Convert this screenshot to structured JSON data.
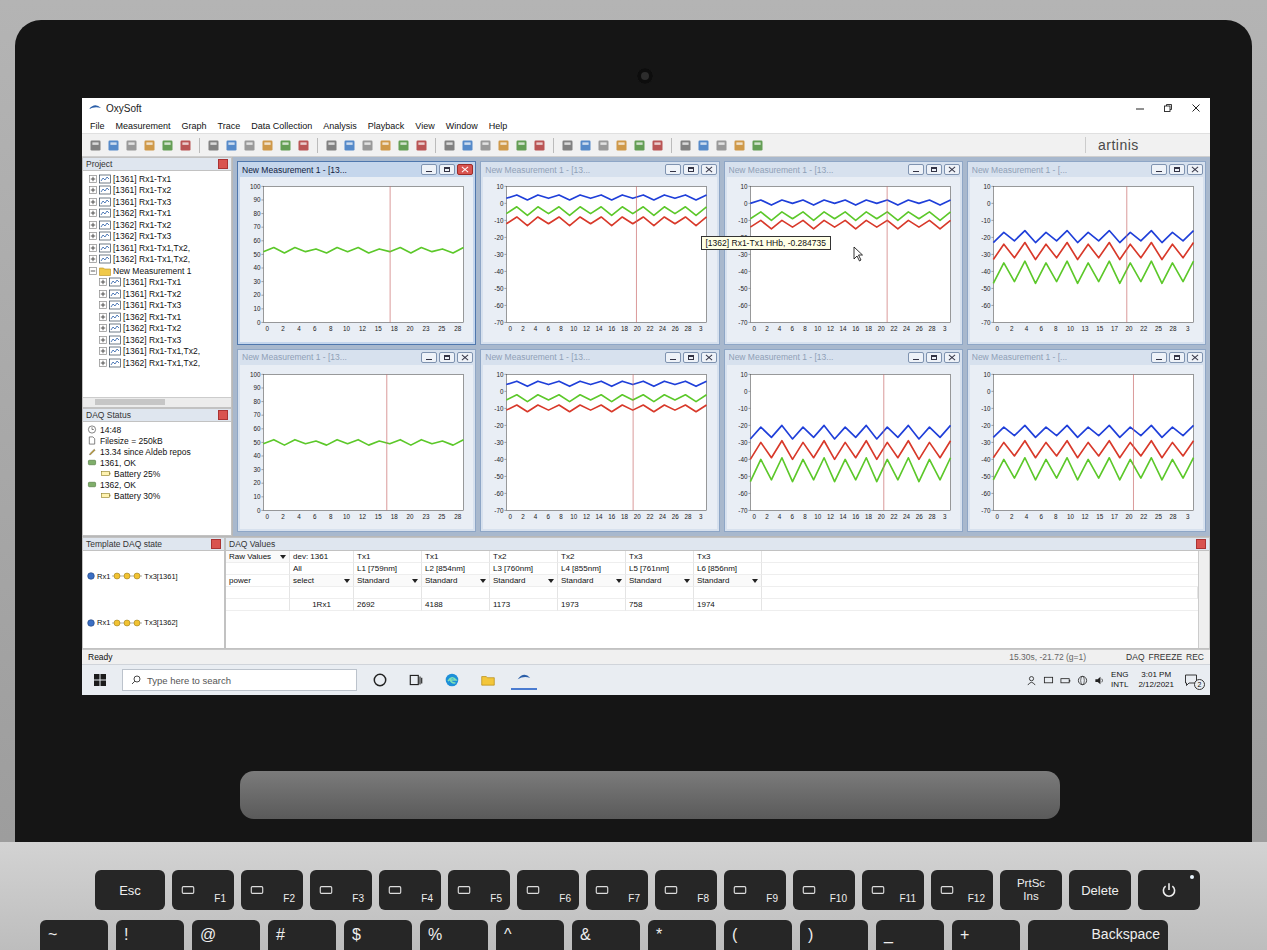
{
  "window": {
    "title": "OxySoft"
  },
  "menu": [
    "File",
    "Measurement",
    "Graph",
    "Trace",
    "Data Collection",
    "Analysis",
    "Playback",
    "View",
    "Window",
    "Help"
  ],
  "toolbar": {
    "logo": "artinis"
  },
  "project": {
    "title": "Project",
    "items": [
      {
        "label": "[1361] Rx1-Tx1",
        "kind": "channel",
        "expanded": false
      },
      {
        "label": "[1361] Rx1-Tx2",
        "kind": "channel",
        "expanded": false
      },
      {
        "label": "[1361] Rx1-Tx3",
        "kind": "channel",
        "expanded": false
      },
      {
        "label": "[1362] Rx1-Tx1",
        "kind": "channel",
        "expanded": false
      },
      {
        "label": "[1362] Rx1-Tx2",
        "kind": "channel",
        "expanded": false
      },
      {
        "label": "[1362] Rx1-Tx3",
        "kind": "channel",
        "expanded": false
      },
      {
        "label": "[1361] Rx1-Tx1,Tx2,",
        "kind": "channel",
        "expanded": false
      },
      {
        "label": "[1362] Rx1-Tx1,Tx2,",
        "kind": "channel",
        "expanded": false
      },
      {
        "label": "New Measurement 1",
        "kind": "folder",
        "expanded": true
      },
      {
        "label": "[1361] Rx1-Tx1",
        "kind": "channel",
        "expanded": false
      },
      {
        "label": "[1361] Rx1-Tx2",
        "kind": "channel",
        "expanded": false
      },
      {
        "label": "[1361] Rx1-Tx3",
        "kind": "channel",
        "expanded": false
      },
      {
        "label": "[1362] Rx1-Tx1",
        "kind": "channel",
        "expanded": false
      },
      {
        "label": "[1362] Rx1-Tx2",
        "kind": "channel",
        "expanded": false
      },
      {
        "label": "[1362] Rx1-Tx3",
        "kind": "channel",
        "expanded": false
      },
      {
        "label": "[1361] Rx1-Tx1,Tx2,",
        "kind": "channel",
        "expanded": false
      },
      {
        "label": "[1362] Rx1-Tx1,Tx2,",
        "kind": "channel",
        "expanded": false
      }
    ]
  },
  "daq_status": {
    "title": "DAQ Status",
    "items": [
      {
        "text": "14:48",
        "kind": "clock"
      },
      {
        "text": "Filesize = 250kB",
        "kind": "file"
      },
      {
        "text": "13.34 since Aldeb repos",
        "kind": "info"
      },
      {
        "text": "1361, OK",
        "kind": "device"
      },
      {
        "text": "Battery 25%",
        "kind": "battery"
      },
      {
        "text": "1362, OK",
        "kind": "device"
      },
      {
        "text": "Battery 30%",
        "kind": "battery"
      }
    ]
  },
  "charts": [
    {
      "title": "New Measurement 1 - [13...",
      "active": true,
      "y_max": 100,
      "y_min": 0,
      "y_ticks": [
        "100",
        "90",
        "80",
        "70",
        "60",
        "50",
        "40",
        "30",
        "20",
        "10",
        "0"
      ],
      "x_ticks": [
        "0",
        "2",
        "4",
        "6",
        "8",
        "10",
        "12",
        "15",
        "18",
        "20",
        "23",
        "25",
        "28"
      ],
      "x_max": 30,
      "cursor": 19,
      "series": [
        {
          "color": "#5cc82a",
          "values": [
            52,
            55,
            51,
            55,
            52,
            54,
            51,
            55,
            52,
            55,
            51,
            54,
            52,
            55,
            51,
            55,
            52,
            54,
            51,
            55
          ]
        }
      ]
    },
    {
      "title": "New Measurement 1 - [13...",
      "active": false,
      "y_max": 10,
      "y_min": -70,
      "y_ticks": [
        "10",
        "0",
        "-10",
        "-20",
        "-30",
        "-40",
        "-50",
        "-60",
        "-70"
      ],
      "x_ticks": [
        "0",
        "2",
        "4",
        "6",
        "8",
        "10",
        "12",
        "14",
        "16",
        "18",
        "20",
        "22",
        "24",
        "26",
        "28",
        "3"
      ],
      "x_max": 30,
      "cursor": 19.5,
      "series": [
        {
          "color": "#1f3fd9",
          "values": [
            3,
            5,
            2,
            5,
            3,
            5,
            2,
            5,
            3,
            5,
            2,
            5,
            3,
            5,
            2,
            5,
            3,
            5,
            2,
            5
          ]
        },
        {
          "color": "#5cc82a",
          "values": [
            -6,
            -2,
            -7,
            -2,
            -6,
            -2,
            -7,
            -2,
            -6,
            -2,
            -7,
            -2,
            -6,
            -2,
            -7,
            -2,
            -6,
            -2,
            -7,
            -2
          ]
        },
        {
          "color": "#d8392a",
          "values": [
            -12,
            -8,
            -13,
            -8,
            -12,
            -8,
            -13,
            -8,
            -12,
            -8,
            -13,
            -8,
            -12,
            -8,
            -13,
            -8,
            -12,
            -8,
            -13,
            -8
          ]
        }
      ]
    },
    {
      "title": "New Measurement 1 - [13...",
      "active": false,
      "y_max": 10,
      "y_min": -70,
      "y_ticks": [
        "10",
        "0",
        "-10",
        "-20",
        "-30",
        "-40",
        "-50",
        "-60",
        "-70"
      ],
      "x_ticks": [
        "0",
        "2",
        "4",
        "6",
        "8",
        "10",
        "12",
        "14",
        "16",
        "18",
        "20",
        "22",
        "24",
        "26",
        "28",
        "3"
      ],
      "x_max": 30,
      "cursor": 20.5,
      "tooltip": "[1362] Rx1-Tx1 HHb, -0.284735",
      "series": [
        {
          "color": "#1f3fd9",
          "values": [
            0,
            2,
            -1,
            2,
            0,
            2,
            -1,
            2,
            0,
            2,
            -1,
            2,
            0,
            2,
            -1,
            2,
            0,
            2,
            -1,
            2
          ]
        },
        {
          "color": "#5cc82a",
          "values": [
            -9,
            -5,
            -10,
            -5,
            -9,
            -5,
            -10,
            -5,
            -9,
            -5,
            -10,
            -5,
            -9,
            -5,
            -10,
            -5,
            -9,
            -5,
            -10,
            -5
          ]
        },
        {
          "color": "#d8392a",
          "values": [
            -14,
            -10,
            -15,
            -10,
            -14,
            -10,
            -15,
            -10,
            -14,
            -10,
            -15,
            -10,
            -14,
            -10,
            -15,
            -10,
            -14,
            -10,
            -15,
            -10
          ]
        }
      ]
    },
    {
      "title": "New Measurement 1 - [...",
      "active": false,
      "y_max": 10,
      "y_min": -70,
      "y_ticks": [
        "10",
        "0",
        "-10",
        "-20",
        "-30",
        "-40",
        "-50",
        "-60",
        "-70"
      ],
      "x_ticks": [
        "0",
        "2",
        "4",
        "6",
        "8",
        "10",
        "13",
        "15",
        "17",
        "20",
        "22",
        "25",
        "28",
        "3"
      ],
      "x_max": 30,
      "cursor": 20,
      "series": [
        {
          "color": "#1f3fd9",
          "values": [
            -23,
            -17,
            -22,
            -16,
            -23,
            -17,
            -22,
            -16,
            -23,
            -17,
            -22,
            -16,
            -23,
            -17,
            -22,
            -16,
            -23,
            -17,
            -22,
            -16
          ]
        },
        {
          "color": "#d8392a",
          "values": [
            -33,
            -24,
            -32,
            -23,
            -33,
            -24,
            -32,
            -23,
            -33,
            -24,
            -32,
            -23,
            -33,
            -24,
            -32,
            -23,
            -33,
            -24,
            -32,
            -23
          ]
        },
        {
          "color": "#5cc82a",
          "values": [
            -47,
            -35,
            -46,
            -34,
            -47,
            -35,
            -46,
            -34,
            -47,
            -35,
            -46,
            -34,
            -47,
            -35,
            -46,
            -34,
            -47,
            -35,
            -46,
            -34
          ]
        }
      ]
    },
    {
      "title": "New Measurement 1 - [13...",
      "active": false,
      "y_max": 100,
      "y_min": 0,
      "y_ticks": [
        "100",
        "90",
        "80",
        "70",
        "60",
        "50",
        "40",
        "30",
        "20",
        "10",
        "0"
      ],
      "x_ticks": [
        "0",
        "2",
        "4",
        "6",
        "8",
        "10",
        "12",
        "15",
        "18",
        "20",
        "23",
        "25",
        "28"
      ],
      "x_max": 30,
      "cursor": 18.5,
      "series": [
        {
          "color": "#5cc82a",
          "values": [
            49,
            52,
            48,
            52,
            49,
            51,
            48,
            52,
            49,
            52,
            48,
            51,
            49,
            52,
            48,
            52,
            49,
            51,
            48,
            52
          ]
        }
      ]
    },
    {
      "title": "New Measurement 1 - [13...",
      "active": false,
      "y_max": 10,
      "y_min": -70,
      "y_ticks": [
        "10",
        "0",
        "-10",
        "-20",
        "-30",
        "-40",
        "-50",
        "-60",
        "-70"
      ],
      "x_ticks": [
        "0",
        "2",
        "4",
        "6",
        "8",
        "10",
        "12",
        "14",
        "16",
        "18",
        "20",
        "22",
        "24",
        "26",
        "28",
        "3"
      ],
      "x_max": 30,
      "cursor": 19,
      "series": [
        {
          "color": "#1f3fd9",
          "values": [
            4,
            6,
            3,
            6,
            4,
            6,
            3,
            6,
            4,
            6,
            3,
            6,
            4,
            6,
            3,
            6,
            4,
            6,
            3,
            6
          ]
        },
        {
          "color": "#5cc82a",
          "values": [
            -5,
            -2,
            -6,
            -2,
            -5,
            -2,
            -6,
            -2,
            -5,
            -2,
            -6,
            -2,
            -5,
            -2,
            -6,
            -2,
            -5,
            -2,
            -6,
            -2
          ]
        },
        {
          "color": "#d8392a",
          "values": [
            -11,
            -8,
            -12,
            -8,
            -11,
            -8,
            -12,
            -8,
            -11,
            -8,
            -12,
            -8,
            -11,
            -8,
            -12,
            -8,
            -11,
            -8,
            -12,
            -8
          ]
        }
      ]
    },
    {
      "title": "New Measurement 1 - [13...",
      "active": false,
      "y_max": 10,
      "y_min": -70,
      "y_ticks": [
        "10",
        "0",
        "-10",
        "-20",
        "-30",
        "-40",
        "-50",
        "-60",
        "-70"
      ],
      "x_ticks": [
        "0",
        "2",
        "4",
        "6",
        "8",
        "10",
        "12",
        "14",
        "16",
        "18",
        "20",
        "22",
        "24",
        "26",
        "28",
        "3"
      ],
      "x_max": 30,
      "cursor": 20,
      "series": [
        {
          "color": "#1f3fd9",
          "values": [
            -28,
            -21,
            -27,
            -20,
            -28,
            -21,
            -27,
            -20,
            -28,
            -21,
            -27,
            -20,
            -28,
            -21,
            -27,
            -20,
            -28,
            -21,
            -27,
            -20
          ]
        },
        {
          "color": "#d8392a",
          "values": [
            -40,
            -30,
            -39,
            -29,
            -40,
            -30,
            -39,
            -29,
            -40,
            -30,
            -39,
            -29,
            -40,
            -30,
            -39,
            -29,
            -40,
            -30,
            -39,
            -29
          ]
        },
        {
          "color": "#5cc82a",
          "values": [
            -53,
            -40,
            -52,
            -39,
            -53,
            -40,
            -52,
            -39,
            -53,
            -40,
            -52,
            -39,
            -53,
            -40,
            -52,
            -39,
            -53,
            -40,
            -52,
            -39
          ]
        }
      ]
    },
    {
      "title": "New Measurement 1 - [...",
      "active": false,
      "y_max": 10,
      "y_min": -70,
      "y_ticks": [
        "10",
        "0",
        "-10",
        "-20",
        "-30",
        "-40",
        "-50",
        "-60",
        "-70"
      ],
      "x_ticks": [
        "0",
        "2",
        "4",
        "6",
        "8",
        "10",
        "12",
        "15",
        "17",
        "20",
        "22",
        "25",
        "28",
        "3"
      ],
      "x_max": 30,
      "cursor": 21,
      "series": [
        {
          "color": "#1f3fd9",
          "values": [
            -27,
            -21,
            -26,
            -20,
            -27,
            -21,
            -26,
            -20,
            -27,
            -21,
            -26,
            -20,
            -27,
            -21,
            -26,
            -20,
            -27,
            -21,
            -26,
            -20
          ]
        },
        {
          "color": "#d8392a",
          "values": [
            -39,
            -30,
            -38,
            -29,
            -39,
            -30,
            -38,
            -29,
            -39,
            -30,
            -38,
            -29,
            -39,
            -30,
            -38,
            -29,
            -39,
            -30,
            -38,
            -29
          ]
        },
        {
          "color": "#5cc82a",
          "values": [
            -52,
            -40,
            -51,
            -39,
            -52,
            -40,
            -51,
            -39,
            -52,
            -40,
            -51,
            -39,
            -52,
            -40,
            -51,
            -39,
            -52,
            -40,
            -51,
            -39
          ]
        }
      ]
    }
  ],
  "template_daq": {
    "title": "Template DAQ state",
    "devices": [
      {
        "rx": "Rx1",
        "tx": "Tx3[1361]"
      },
      {
        "rx": "Rx1",
        "tx": "Tx3[1362]"
      }
    ]
  },
  "daq_values": {
    "title": "DAQ Values",
    "mode": "Raw Values",
    "device": "dev: 1361",
    "filter": "All",
    "row_label": "power",
    "select": "select",
    "columns": [
      {
        "tx": "Tx1",
        "wavelength": "L1 [759nm]",
        "setting": "Standard"
      },
      {
        "tx": "Tx1",
        "wavelength": "L2 [854nm]",
        "setting": "Standard"
      },
      {
        "tx": "Tx2",
        "wavelength": "L3 [760nm]",
        "setting": "Standard"
      },
      {
        "tx": "Tx2",
        "wavelength": "L4 [855nm]",
        "setting": "Standard"
      },
      {
        "tx": "Tx3",
        "wavelength": "L5 [761nm]",
        "setting": "Standard"
      },
      {
        "tx": "Tx3",
        "wavelength": "L6 [856nm]",
        "setting": "Standard"
      }
    ],
    "rows": [
      {
        "label": "1Rx1",
        "values": [
          "2692",
          "4188",
          "1173",
          "1973",
          "758",
          "1974"
        ]
      }
    ]
  },
  "status_bar": {
    "left": "Ready",
    "reading": "15.30s, -21.72 (g=1)",
    "indicators": [
      "DAQ",
      "FREEZE",
      "REC"
    ]
  },
  "taskbar": {
    "search_placeholder": "Type here to search",
    "language": "ENG",
    "layout": "INTL",
    "time": "3:01 PM",
    "date": "2/12/2021",
    "notifications": "2"
  },
  "keyboard": {
    "rows": [
      [
        {
          "label": "Esc",
          "kind": "text"
        },
        {
          "label": "F1",
          "kind": "fn"
        },
        {
          "label": "F2",
          "kind": "fn"
        },
        {
          "label": "F3",
          "kind": "fn"
        },
        {
          "label": "F4",
          "kind": "fn"
        },
        {
          "label": "F5",
          "kind": "fn"
        },
        {
          "label": "F6",
          "kind": "fn"
        },
        {
          "label": "F7",
          "kind": "fn"
        },
        {
          "label": "F8",
          "kind": "fn"
        },
        {
          "label": "F9",
          "kind": "fn"
        },
        {
          "label": "F10",
          "kind": "fn"
        },
        {
          "label": "F11",
          "kind": "fn"
        },
        {
          "label": "F12",
          "kind": "fn"
        },
        {
          "label": "PrtSc",
          "sub": "Ins",
          "kind": "double"
        },
        {
          "label": "Delete",
          "kind": "text"
        },
        {
          "kind": "power"
        }
      ],
      [
        {
          "label": "~",
          "kind": "symbol"
        },
        {
          "label": "!",
          "kind": "symbol"
        },
        {
          "label": "@",
          "kind": "symbol"
        },
        {
          "label": "#",
          "kind": "symbol"
        },
        {
          "label": "$",
          "kind": "symbol"
        },
        {
          "label": "%",
          "kind": "symbol"
        },
        {
          "label": "^",
          "kind": "symbol"
        },
        {
          "label": "&",
          "kind": "symbol"
        },
        {
          "label": "*",
          "kind": "symbol"
        },
        {
          "label": "(",
          "kind": "symbol"
        },
        {
          "label": ")",
          "kind": "symbol"
        },
        {
          "label": "_",
          "kind": "symbol"
        },
        {
          "label": "+",
          "kind": "symbol"
        },
        {
          "label": "Backspace",
          "kind": "wide"
        }
      ]
    ]
  }
}
